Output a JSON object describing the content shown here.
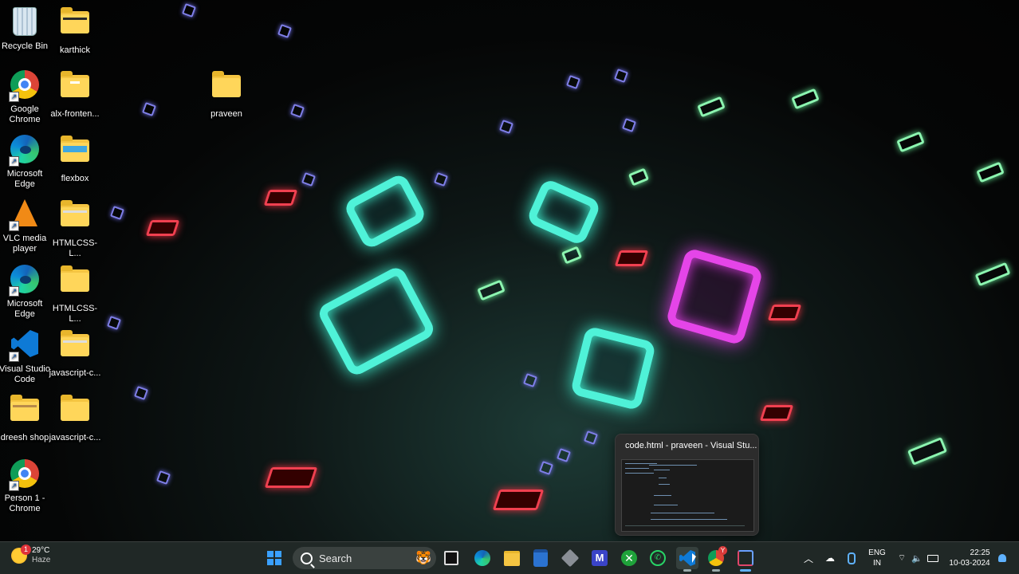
{
  "desktop": {
    "icons": [
      {
        "label": "Recycle Bin",
        "icon": "recycle-bin-icon"
      },
      {
        "label": "karthick",
        "icon": "folder-icon"
      },
      {
        "label": "Google Chrome",
        "icon": "chrome-icon"
      },
      {
        "label": "alx-fronten...",
        "icon": "folder-icon"
      },
      {
        "label": "praveen",
        "icon": "folder-icon"
      },
      {
        "label": "Microsoft Edge",
        "icon": "edge-icon"
      },
      {
        "label": "flexbox",
        "icon": "folder-icon"
      },
      {
        "label": "VLC media player",
        "icon": "vlc-icon"
      },
      {
        "label": "HTMLCSS-L...",
        "icon": "folder-icon"
      },
      {
        "label": "Microsoft Edge",
        "icon": "edge-icon"
      },
      {
        "label": "HTMLCSS-L...",
        "icon": "folder-icon"
      },
      {
        "label": "Visual Studio Code",
        "icon": "vscode-icon"
      },
      {
        "label": "javascript-c...",
        "icon": "folder-icon"
      },
      {
        "label": "dreesh shop",
        "icon": "folder-icon"
      },
      {
        "label": "javascript-c...",
        "icon": "folder-icon"
      },
      {
        "label": "Person 1 - Chrome",
        "icon": "chrome-icon"
      }
    ]
  },
  "preview": {
    "title": "code.html - praveen - Visual Stu..."
  },
  "taskbar": {
    "weather": {
      "temp": "29°C",
      "condition": "Haze",
      "badge": "1"
    },
    "search_placeholder": "Search",
    "chrome_badge": "Y",
    "language": {
      "line1": "ENG",
      "line2": "IN"
    },
    "clock": {
      "time": "22:25",
      "date": "10-03-2024"
    }
  },
  "colors": {
    "taskbar_bg": "#202826",
    "accent": "#5fb2ff",
    "neon_cyan": "#4ff2d8",
    "neon_pink": "#e545e8"
  }
}
